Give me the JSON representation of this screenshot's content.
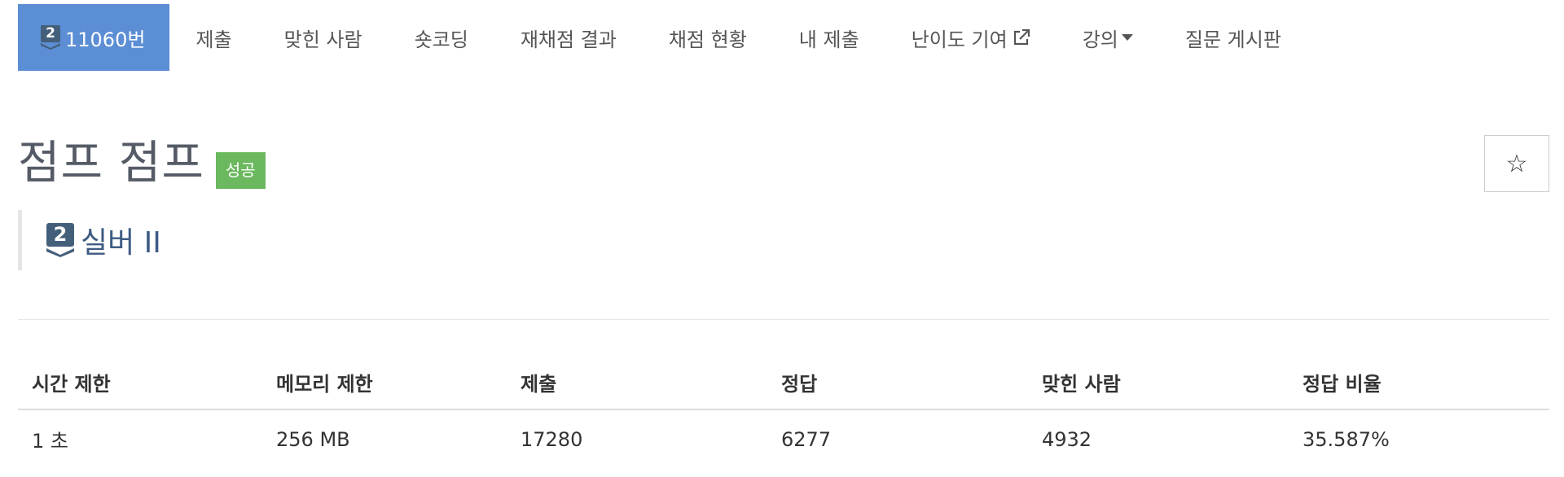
{
  "nav": {
    "problem_tab": {
      "tier_number": "2",
      "label": "11060번"
    },
    "items": [
      {
        "label": "제출"
      },
      {
        "label": "맞힌 사람"
      },
      {
        "label": "숏코딩"
      },
      {
        "label": "재채점 결과"
      },
      {
        "label": "채점 현황"
      },
      {
        "label": "내 제출"
      },
      {
        "label": "난이도 기여",
        "icon": "external-link-icon"
      },
      {
        "label": "강의",
        "icon": "caret-down-icon"
      },
      {
        "label": "질문 게시판"
      }
    ]
  },
  "problem": {
    "title": "점프 점프",
    "status_badge": "성공",
    "star_glyph": "☆",
    "tier": {
      "number": "2",
      "label": "실버 II",
      "color": "#435f7a"
    }
  },
  "info_table": {
    "headers": [
      "시간 제한",
      "메모리 제한",
      "제출",
      "정답",
      "맞힌 사람",
      "정답 비율"
    ],
    "rows": [
      [
        "1 초",
        "256 MB",
        "17280",
        "6277",
        "4932",
        "35.587%"
      ]
    ]
  },
  "colors": {
    "active_tab": "#5b8ed4",
    "success_badge": "#6bb85f",
    "tier_silver": "#435f7a"
  }
}
